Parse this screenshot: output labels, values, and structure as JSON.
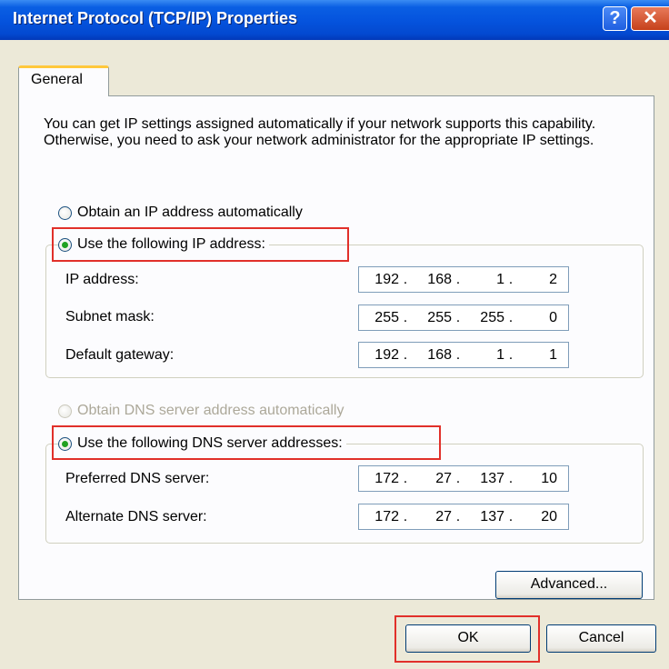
{
  "window": {
    "title": "Internet Protocol (TCP/IP) Properties",
    "help_glyph": "?",
    "close_glyph": "✕"
  },
  "tab": {
    "label": "General"
  },
  "intro_text": "You can get IP settings assigned automatically if your network supports this capability. Otherwise, you need to ask your network administrator for the appropriate IP settings.",
  "ip_section": {
    "auto_label": "Obtain an IP address automatically",
    "manual_label": "Use the following IP address:",
    "selected": "manual",
    "fields": [
      {
        "label": "IP address:",
        "octets": [
          "192",
          "168",
          "1",
          "2"
        ]
      },
      {
        "label": "Subnet mask:",
        "octets": [
          "255",
          "255",
          "255",
          "0"
        ]
      },
      {
        "label": "Default gateway:",
        "octets": [
          "192",
          "168",
          "1",
          "1"
        ]
      }
    ]
  },
  "dns_section": {
    "auto_label": "Obtain DNS server address automatically",
    "auto_disabled": true,
    "manual_label": "Use the following DNS server addresses:",
    "selected": "manual",
    "fields": [
      {
        "label": "Preferred DNS server:",
        "octets": [
          "172",
          "27",
          "137",
          "10"
        ]
      },
      {
        "label": "Alternate DNS server:",
        "octets": [
          "172",
          "27",
          "137",
          "20"
        ]
      }
    ]
  },
  "buttons": {
    "advanced": "Advanced...",
    "ok": "OK",
    "cancel": "Cancel"
  },
  "colors": {
    "titlebar": "#0554de",
    "highlight": "#e1302a",
    "radio_dot": "#21a121"
  }
}
